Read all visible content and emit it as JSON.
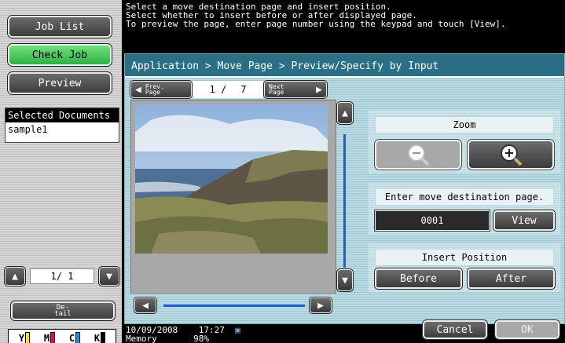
{
  "left": {
    "job_list": "Job List",
    "check_job": "Check Job",
    "preview": "Preview",
    "selected_docs_header": "Selected Documents",
    "selected_docs": [
      "sample1"
    ],
    "page_current": "1/",
    "page_total": "1",
    "detail_line1": "De-",
    "detail_line2": "tail",
    "toner": [
      "Y",
      "M",
      "C",
      "K"
    ]
  },
  "message": {
    "line1": "Select a move destination page and insert position.",
    "line2": "Select whether to insert before or after displayed page.",
    "line3": "To preview the page, enter page number using the keypad and touch [View]."
  },
  "breadcrumb": "Application > Move Page > Preview/Specify by Input",
  "nav": {
    "prev_line1": "Prev.",
    "prev_line2": "Page",
    "page_current": "1 /",
    "page_total": "7",
    "next_line1": "Next",
    "next_line2": "Page"
  },
  "zoom": {
    "title": "Zoom",
    "out_icon": "zoom-out-icon",
    "in_icon": "zoom-in-icon"
  },
  "destination": {
    "title": "Enter move destination page.",
    "value": "0001",
    "view_label": "View"
  },
  "insert": {
    "title": "Insert Position",
    "before": "Before",
    "after": "After"
  },
  "footer": {
    "date": "10/09/2008",
    "time": "17:27",
    "memory_label": "Memory",
    "memory_value": "98%",
    "cancel": "Cancel",
    "ok": "OK"
  },
  "colors": {
    "panel_header": "#2b6f86",
    "green_button": "#3fc257",
    "scroll_track": "#1a5fd1"
  }
}
